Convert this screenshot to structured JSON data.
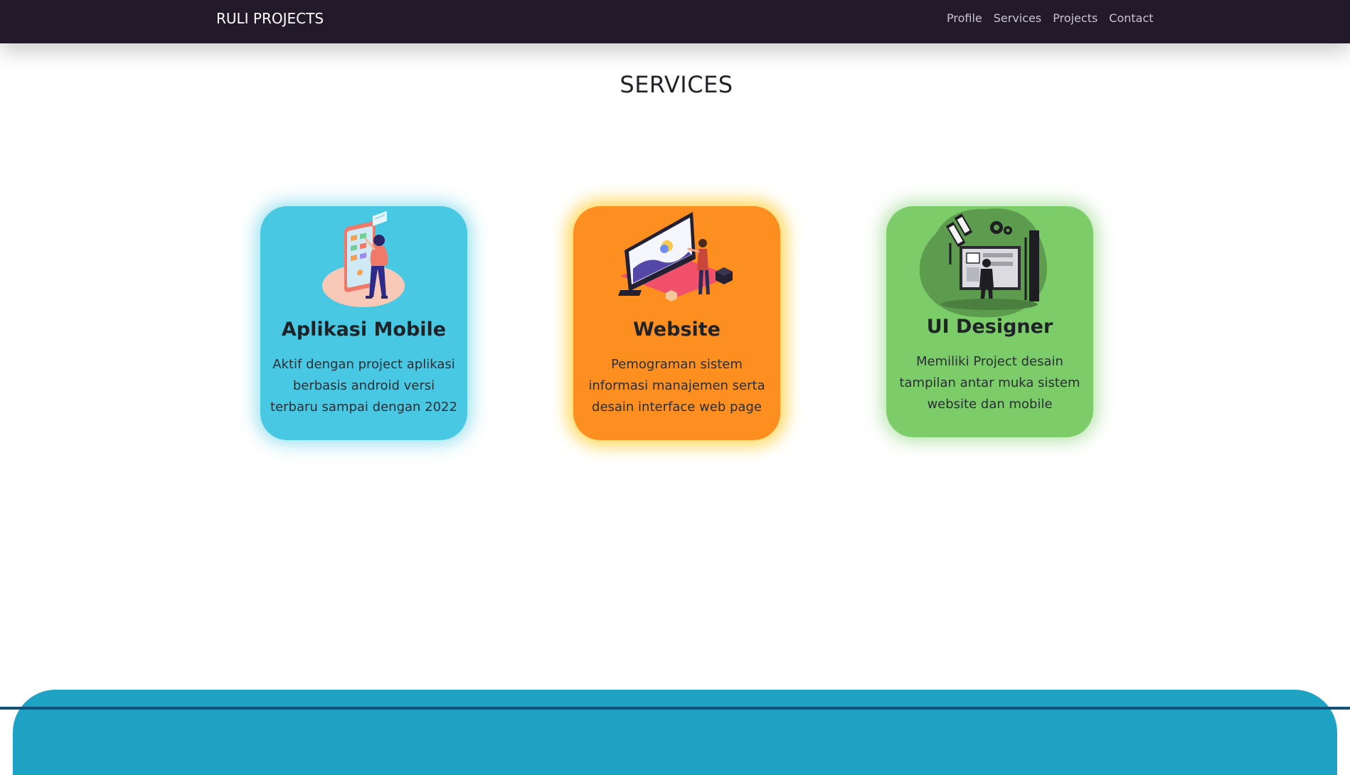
{
  "navbar": {
    "brand": "RULI PROJECTS",
    "links": [
      "Profile",
      "Services",
      "Projects",
      "Contact"
    ],
    "background": "#221a2b"
  },
  "section": {
    "title": "SERVICES"
  },
  "cards": [
    {
      "title": "Aplikasi Mobile",
      "description": "Aktif dengan project aplikasi berbasis android versi terbaru sampai dengan 2022",
      "color": "#48c8e3",
      "glow": "#48c8e3",
      "icon": "mobile-app-illustration-icon"
    },
    {
      "title": "Website",
      "description": "Pemograman sistem informasi manajemen serta desain interface web page",
      "color": "#fd8f21",
      "glow": "#ffc81e",
      "icon": "website-illustration-icon"
    },
    {
      "title": "UI Designer",
      "description": "Memiliki Project desain tampilan antar muka sistem website dan mobile",
      "color": "#7ccd69",
      "glow": "#7ccd69",
      "icon": "ui-designer-illustration-icon"
    }
  ],
  "footer": {
    "color": "#1fa3c4"
  }
}
